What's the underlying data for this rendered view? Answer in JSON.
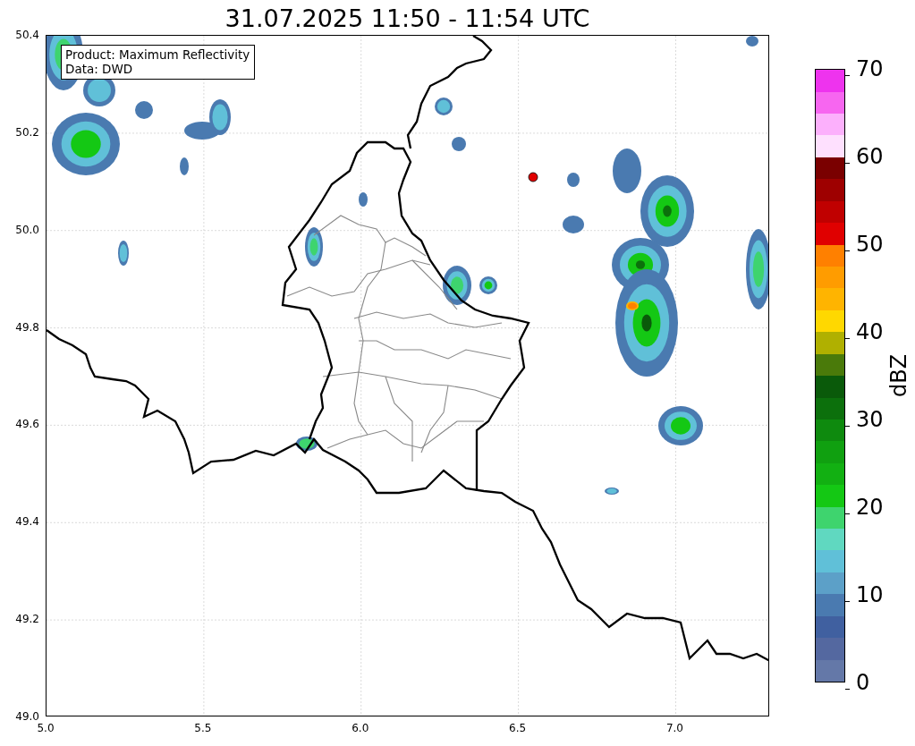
{
  "title": "31.07.2025 11:50 - 11:54 UTC",
  "annotation": {
    "lines": [
      "Product: Maximum Reflectivity",
      "Data: DWD"
    ]
  },
  "x_axis": {
    "ticks": [
      "5.0",
      "5.5",
      "6.0",
      "6.5",
      "7.0"
    ]
  },
  "y_axis": {
    "ticks": [
      "50.4",
      "50.2",
      "50.0",
      "49.8",
      "49.6",
      "49.4",
      "49.2",
      "49.0"
    ]
  },
  "colorbar": {
    "label": "dBZ",
    "ticks": [
      "70",
      "60",
      "50",
      "40",
      "30",
      "20",
      "10",
      "0"
    ],
    "bands": [
      {
        "color": "#6478a8"
      },
      {
        "color": "#5468a0"
      },
      {
        "color": "#4060a0"
      },
      {
        "color": "#4a7ab0"
      },
      {
        "color": "#5ca0c8"
      },
      {
        "color": "#60c0d8"
      },
      {
        "color": "#60d8c0"
      },
      {
        "color": "#3ed46e"
      },
      {
        "color": "#14c814"
      },
      {
        "color": "#12b012"
      },
      {
        "color": "#10a010"
      },
      {
        "color": "#0e8a0e"
      },
      {
        "color": "#0c700c"
      },
      {
        "color": "#0a5a0a"
      },
      {
        "color": "#4a7a0a"
      },
      {
        "color": "#b0b000"
      },
      {
        "color": "#ffd800"
      },
      {
        "color": "#ffb400"
      },
      {
        "color": "#ff9c00"
      },
      {
        "color": "#ff8000"
      },
      {
        "color": "#e00000"
      },
      {
        "color": "#c00000"
      },
      {
        "color": "#9e0000"
      },
      {
        "color": "#7a0000"
      },
      {
        "color": "#fee0fe"
      },
      {
        "color": "#fcb0fc"
      },
      {
        "color": "#f766f0"
      },
      {
        "color": "#ee33ee"
      }
    ]
  }
}
